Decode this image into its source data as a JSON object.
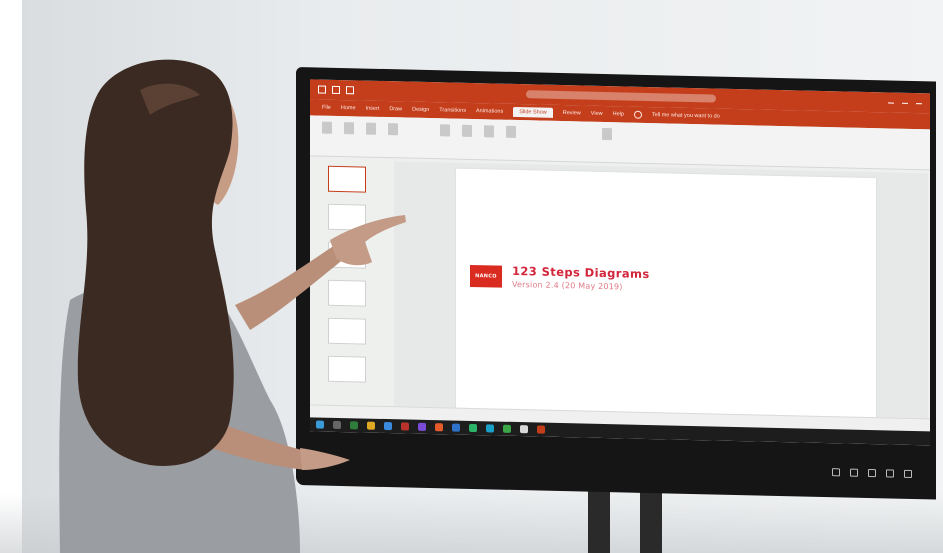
{
  "slide": {
    "logo_text": "NANCO",
    "title": "123 Steps Diagrams",
    "version": "Version 2.4 (20 May 2019)"
  },
  "colors": {
    "ribbon_red": "#c43e1c",
    "title_red": "#d3253b",
    "logo_red": "#d92b20",
    "bezel": "#151515"
  },
  "ribbon": {
    "tabs": [
      "File",
      "Home",
      "Insert",
      "Draw",
      "Design",
      "Transitions",
      "Animations",
      "Slide Show",
      "Review",
      "View",
      "Help"
    ],
    "active_tab": "Slide Show",
    "tell_me": "Tell me what you want to do"
  },
  "icons": [
    "windows-start-icon",
    "search-icon",
    "taskbar-app-icons",
    "tray-icons"
  ]
}
